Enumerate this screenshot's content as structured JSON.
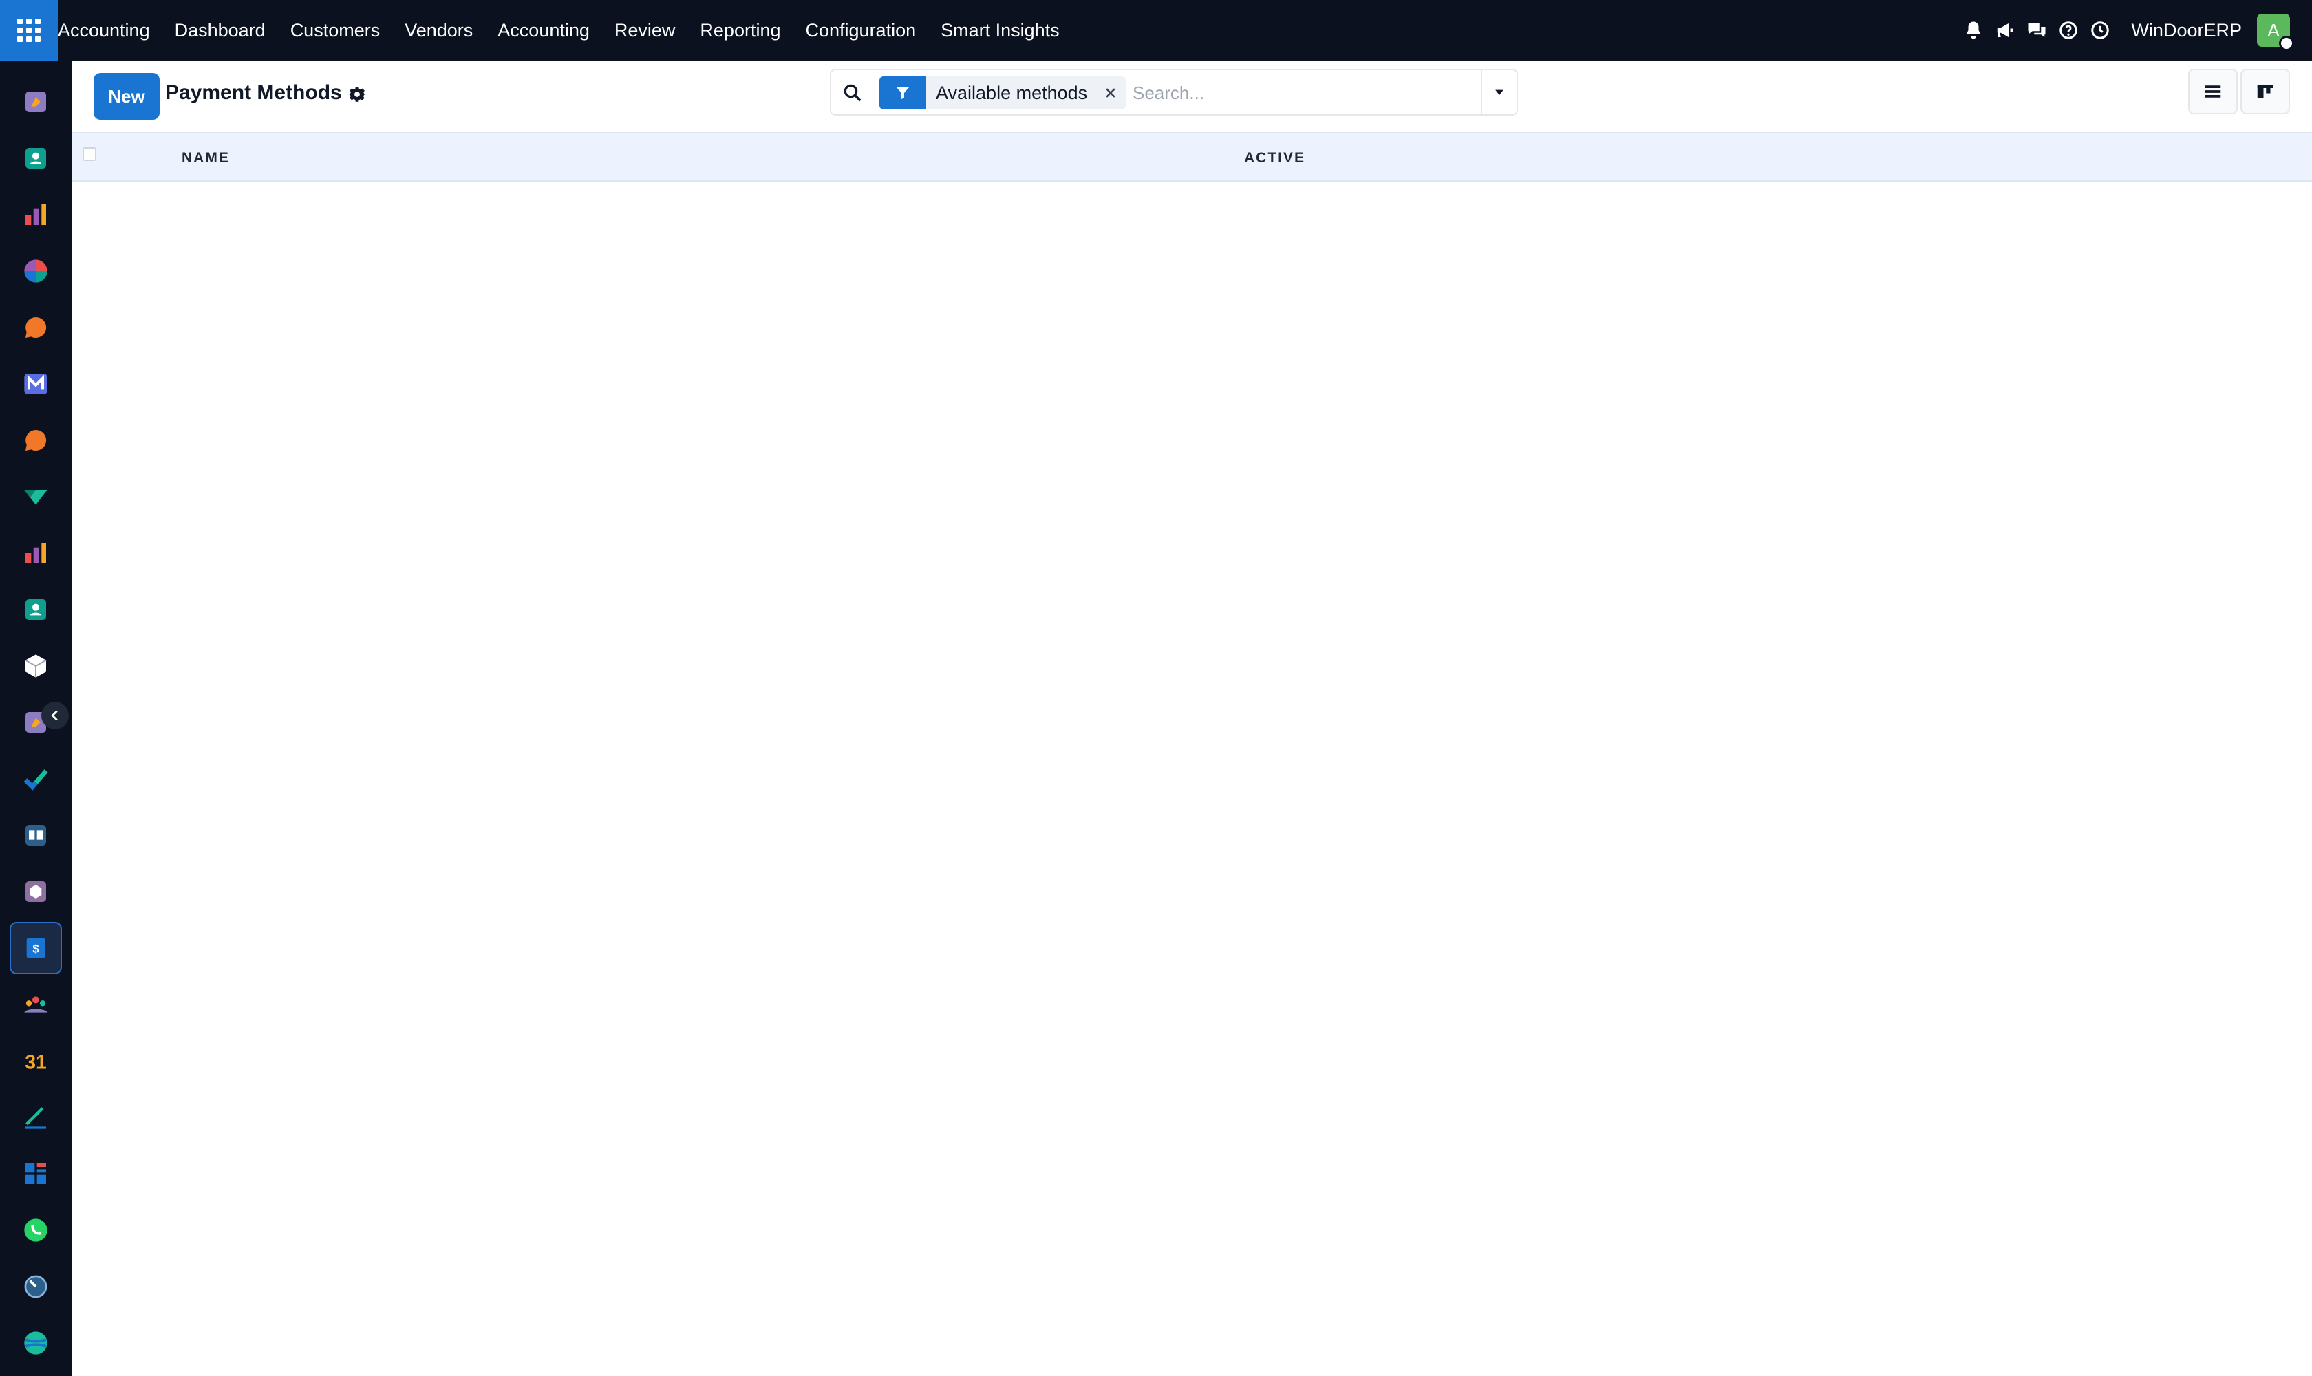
{
  "topbar": {
    "brand": "Accounting",
    "menu": [
      "Dashboard",
      "Customers",
      "Vendors",
      "Accounting",
      "Review",
      "Reporting",
      "Configuration",
      "Smart Insights"
    ],
    "company": "WinDoorERP",
    "avatar_initial": "A",
    "icons": [
      "bell-icon",
      "megaphone-icon",
      "chat-icon",
      "help-icon",
      "clock-icon"
    ]
  },
  "sidebar": {
    "apps": [
      "discuss",
      "contacts",
      "dashboards",
      "project",
      "livechat",
      "mail",
      "livechat-2",
      "expenses",
      "dashboards-2",
      "employees",
      "inventory",
      "discuss-2",
      "todo",
      "knowledge",
      "products",
      "payments",
      "team",
      "calendar",
      "sign",
      "spreadsheet",
      "whatsapp",
      "time-off",
      "website"
    ],
    "active": "payments"
  },
  "control_panel": {
    "new_label": "New",
    "title": "Payment Methods",
    "search": {
      "facet_label": "Available methods",
      "placeholder": "Search..."
    }
  },
  "list": {
    "columns": [
      "NAME",
      "ACTIVE"
    ],
    "rows": []
  },
  "colors": {
    "navbar": "#0b111f",
    "primary": "#1a75d2",
    "header_row": "#ecf3fe"
  }
}
